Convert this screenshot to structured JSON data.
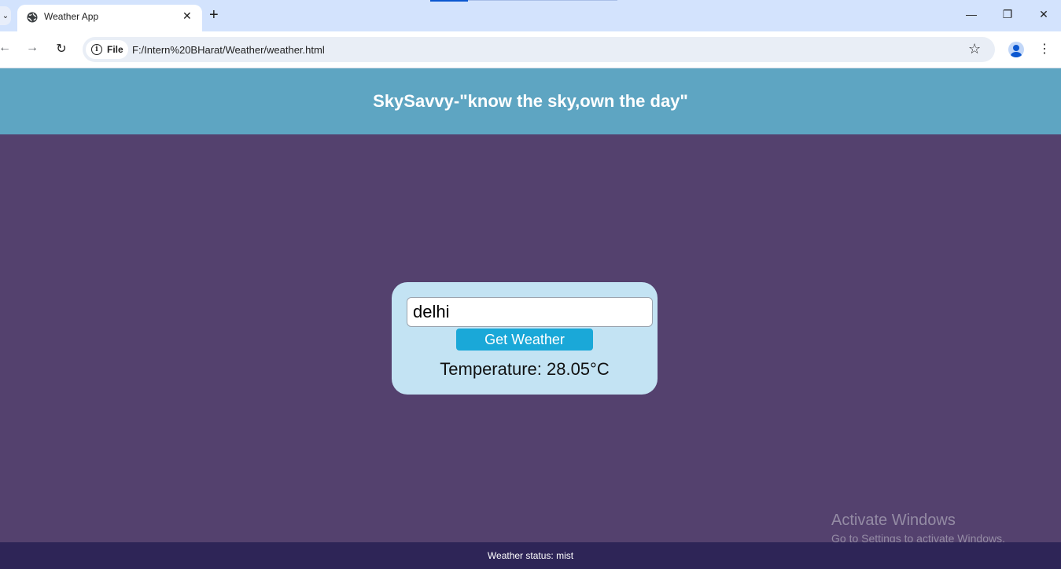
{
  "browser": {
    "tab_title": "Weather App",
    "new_tab_label": "+",
    "tab_close_label": "✕",
    "tab_list_label": "⌄",
    "window_controls": {
      "minimize": "—",
      "restore": "❐",
      "close": "✕"
    },
    "nav": {
      "back": "←",
      "forward": "→",
      "reload": "↻"
    },
    "site_chip_label": "File",
    "url": "F:/Intern%20BHarat/Weather/weather.html",
    "bookmark_icon": "☆",
    "menu_icon": "⋮"
  },
  "header": {
    "title": "SkySavvy-\"know the sky,own the day\""
  },
  "weather_card": {
    "city_value": "delhi",
    "button_label": "Get Weather",
    "temperature_text": "Temperature: 28.05°C"
  },
  "watermark": {
    "title": "Activate Windows",
    "subtitle": "Go to Settings to activate Windows."
  },
  "footer": {
    "status_text": "Weather status: mist"
  },
  "colors": {
    "header_bg": "#5ea5c2",
    "page_bg": "#54416e",
    "card_bg": "#c3e3f3",
    "button_bg": "#1aa8d8",
    "footer_bg": "#2e2557"
  }
}
